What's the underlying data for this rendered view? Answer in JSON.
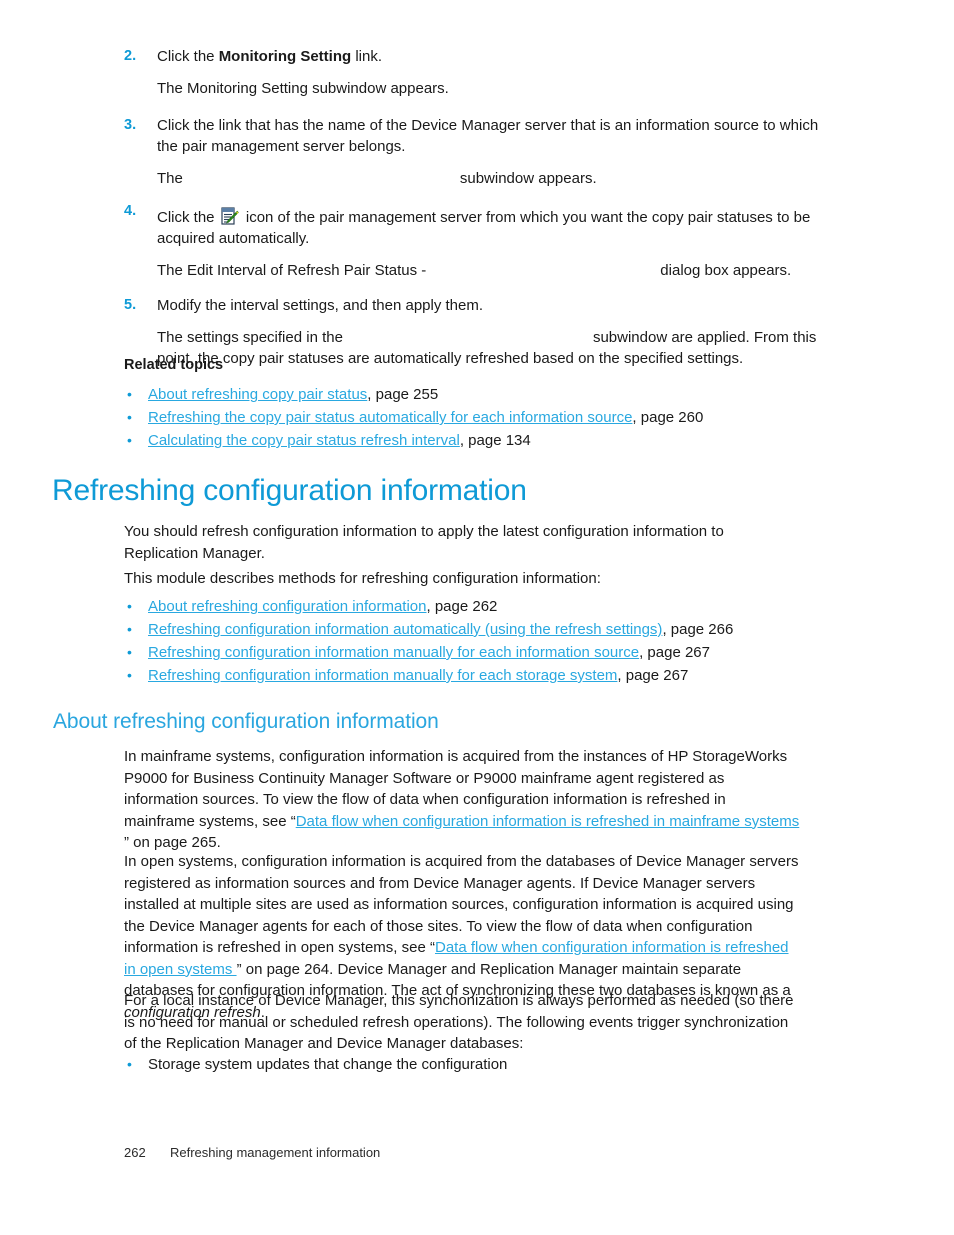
{
  "document": {
    "type": "technical-manual-page",
    "colors": {
      "heading_blue": "#0e9ad6",
      "link_blue": "#29a8e0",
      "body_text": "#1a1a1a",
      "bullet_blue": "#0e9ad6"
    }
  },
  "steps": [
    {
      "number": "2.",
      "text_before_bold": "Click the ",
      "bold": "Monitoring Setting",
      "text_after_bold": " link.",
      "follow_up": "The Monitoring Setting subwindow appears."
    },
    {
      "number": "3.",
      "text": "Click the link that has the name of the Device Manager server that is an information source to which the pair management server belongs.",
      "follow_up_prefix": "The",
      "follow_up_suffix": "subwindow appears."
    },
    {
      "number": "4.",
      "text_before_icon": "Click the ",
      "icon": "edit-document-icon",
      "text_after_icon": " icon of the pair management server from which you want the copy pair statuses to be acquired automatically.",
      "follow_up_prefix": "The Edit Interval of Refresh Pair Status -",
      "follow_up_suffix": "dialog box appears."
    },
    {
      "number": "5.",
      "text": "Modify the interval settings, and then apply them.",
      "follow_up_prefix": "The settings specified in the",
      "follow_up_suffix": "subwindow are applied. From this point, the copy pair statuses are automatically refreshed based on the specified settings."
    }
  ],
  "related_topics": {
    "heading": "Related topics",
    "items": [
      {
        "link": "About refreshing copy pair status",
        "page": ", page 255"
      },
      {
        "link": "Refreshing the copy pair status automatically for each information source",
        "page": ", page 260"
      },
      {
        "link": "Calculating the copy pair status refresh interval",
        "page": ", page 134"
      }
    ]
  },
  "chapter": {
    "title": "Refreshing configuration information",
    "intro": "You should refresh configuration information to apply the latest configuration information to Replication Manager.",
    "module_line": "This module describes methods for refreshing configuration information:",
    "module_items": [
      {
        "link": "About refreshing configuration information",
        "page": ", page 262"
      },
      {
        "link": "Refreshing configuration information automatically (using the refresh settings)",
        "page": ", page 266"
      },
      {
        "link": "Refreshing configuration information manually for each information source",
        "page": ", page 267"
      },
      {
        "link": "Refreshing configuration information manually for each storage system",
        "page": ", page 267"
      }
    ]
  },
  "section": {
    "title": "About refreshing configuration information",
    "para1_before_link": "In mainframe systems, configuration information is acquired from the instances of HP StorageWorks P9000 for Business Continuity Manager Software or P9000 mainframe agent registered as information sources. To view the flow of data when configuration information is refreshed in mainframe systems, see “",
    "para1_link": "Data flow when configuration information is refreshed in mainframe systems ",
    "para1_after_link": "” on page 265.",
    "para2_before_link": "In open systems, configuration information is acquired from the databases of Device Manager servers registered as information sources and from Device Manager agents. If Device Manager servers installed at multiple sites are used as information sources, configuration information is acquired using the Device Manager agents for each of those sites. To view the flow of data when configuration information is refreshed in open systems, see “",
    "para2_link": "Data flow when configuration information is refreshed in open systems ",
    "para2_after_link_a": "” on page 264. Device Manager and Replication Manager maintain separate databases for configuration information. The act of synchronizing these two databases is known as a ",
    "para2_italic": "configuration refresh",
    "para2_after_link_b": ".",
    "para3": "For a local instance of Device Manager, this synchonization is always performed as needed (so there is no need for manual or scheduled refresh operations). The following events trigger synchronization of the Replication Manager and Device Manager databases:",
    "bullets": [
      {
        "text": "Storage system updates that change the configuration"
      }
    ]
  },
  "footer": {
    "page_number": "262",
    "running_head": "Refreshing management information"
  }
}
